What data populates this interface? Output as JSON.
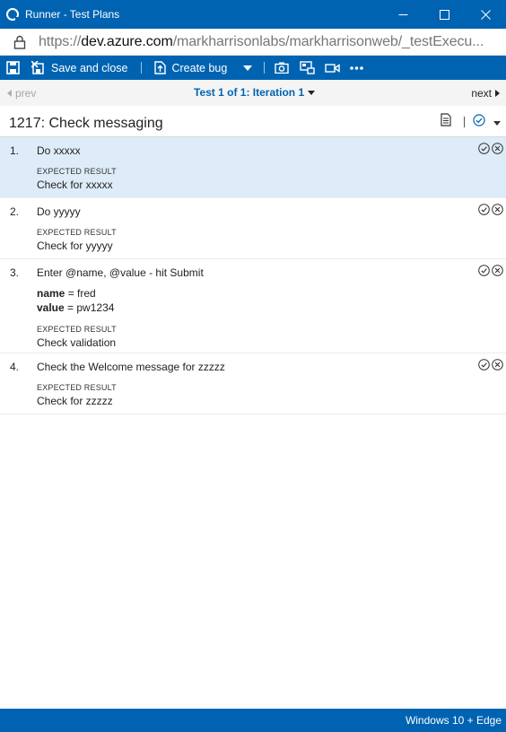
{
  "window": {
    "title": "Runner - Test Plans",
    "url_prefix": "https://",
    "url_host": "dev.azure.com",
    "url_rest": "/markharrisonlabs/markharrisonweb/_testExecu..."
  },
  "toolbar": {
    "save_close_label": "Save and close",
    "create_bug_label": "Create bug"
  },
  "nav": {
    "prev_label": "prev",
    "iteration_label": "Test 1 of 1: Iteration 1",
    "next_label": "next"
  },
  "test_case": {
    "title": "1217: Check messaging"
  },
  "steps": [
    {
      "number": "1.",
      "action": "Do xxxxx",
      "expected_label": "EXPECTED RESULT",
      "expected": "Check for xxxxx"
    },
    {
      "number": "2.",
      "action": "Do yyyyy",
      "expected_label": "EXPECTED RESULT",
      "expected": "Check for yyyyy"
    },
    {
      "number": "3.",
      "action": "Enter @name, @value - hit Submit",
      "params": [
        {
          "name": "name",
          "eq": " = ",
          "value": "fred"
        },
        {
          "name": "value",
          "eq": " = ",
          "value": "pw1234"
        }
      ],
      "expected_label": "EXPECTED RESULT",
      "expected": "Check validation"
    },
    {
      "number": "4.",
      "action": "Check the Welcome message for zzzzz",
      "expected_label": "EXPECTED RESULT",
      "expected": "Check for zzzzz"
    }
  ],
  "status_bar": {
    "environment": "Windows 10 + Edge"
  },
  "colors": {
    "accent": "#0063b1",
    "selected_row": "#deecf9"
  },
  "icons": {
    "app": "azure-devops-icon",
    "lock": "lock-icon",
    "save": "save-icon",
    "save_close": "save-close-icon",
    "create_bug": "bug-icon",
    "screenshot": "camera-icon",
    "capture_actions": "capture-actions-icon",
    "record": "video-icon",
    "more": "more-icon",
    "notes": "document-icon",
    "pass": "pass-icon",
    "fail": "fail-icon"
  }
}
